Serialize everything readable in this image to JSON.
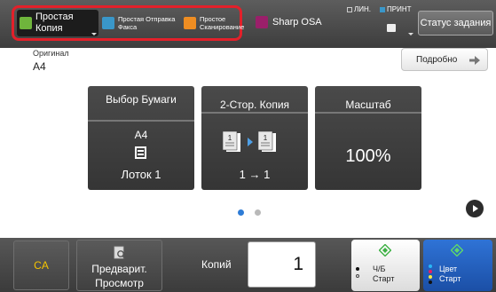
{
  "topbar": {
    "apps": [
      {
        "label": "Простая Копия",
        "icon": "copy-icon"
      },
      {
        "label": "Простая Отправка Факса",
        "icon": "fax-icon"
      },
      {
        "label": "Простое Сканирование",
        "icon": "scan-icon"
      }
    ],
    "device": {
      "label": "Sharp OSA",
      "icon": "sharp-osa-icon"
    },
    "indicators": [
      {
        "label": "ЛИН.",
        "state": "off"
      },
      {
        "label": "ПРИНТ",
        "state": "on"
      }
    ],
    "job_status_label": "Статус задания",
    "colors": {
      "highlight": "#e3202a",
      "copy": "#6fb53c",
      "fax": "#3a97c9",
      "scan": "#ee8d22",
      "osa": "#9a1f6a"
    }
  },
  "original": {
    "label": "Оригинал",
    "value": "A4"
  },
  "detail_button": "Подробно",
  "tiles": {
    "paper": {
      "title": "Выбор Бумаги",
      "size": "A4",
      "tray": "Лоток 1"
    },
    "duplex": {
      "title": "2-Стор. Копия",
      "value": "1 → 1"
    },
    "zoom": {
      "title": "Масштаб",
      "value": "100%"
    }
  },
  "pager": {
    "pages": 2,
    "current": 1
  },
  "bottom": {
    "ca_label": "CA",
    "preview_line1": "Предварит.",
    "preview_line2": "Просмотр",
    "copies_label": "Копий",
    "copies_value": "1",
    "start_bw": {
      "line1": "Ч/Б",
      "line2": "Старт"
    },
    "start_color": {
      "line1": "Цвет",
      "line2": "Старт"
    }
  }
}
